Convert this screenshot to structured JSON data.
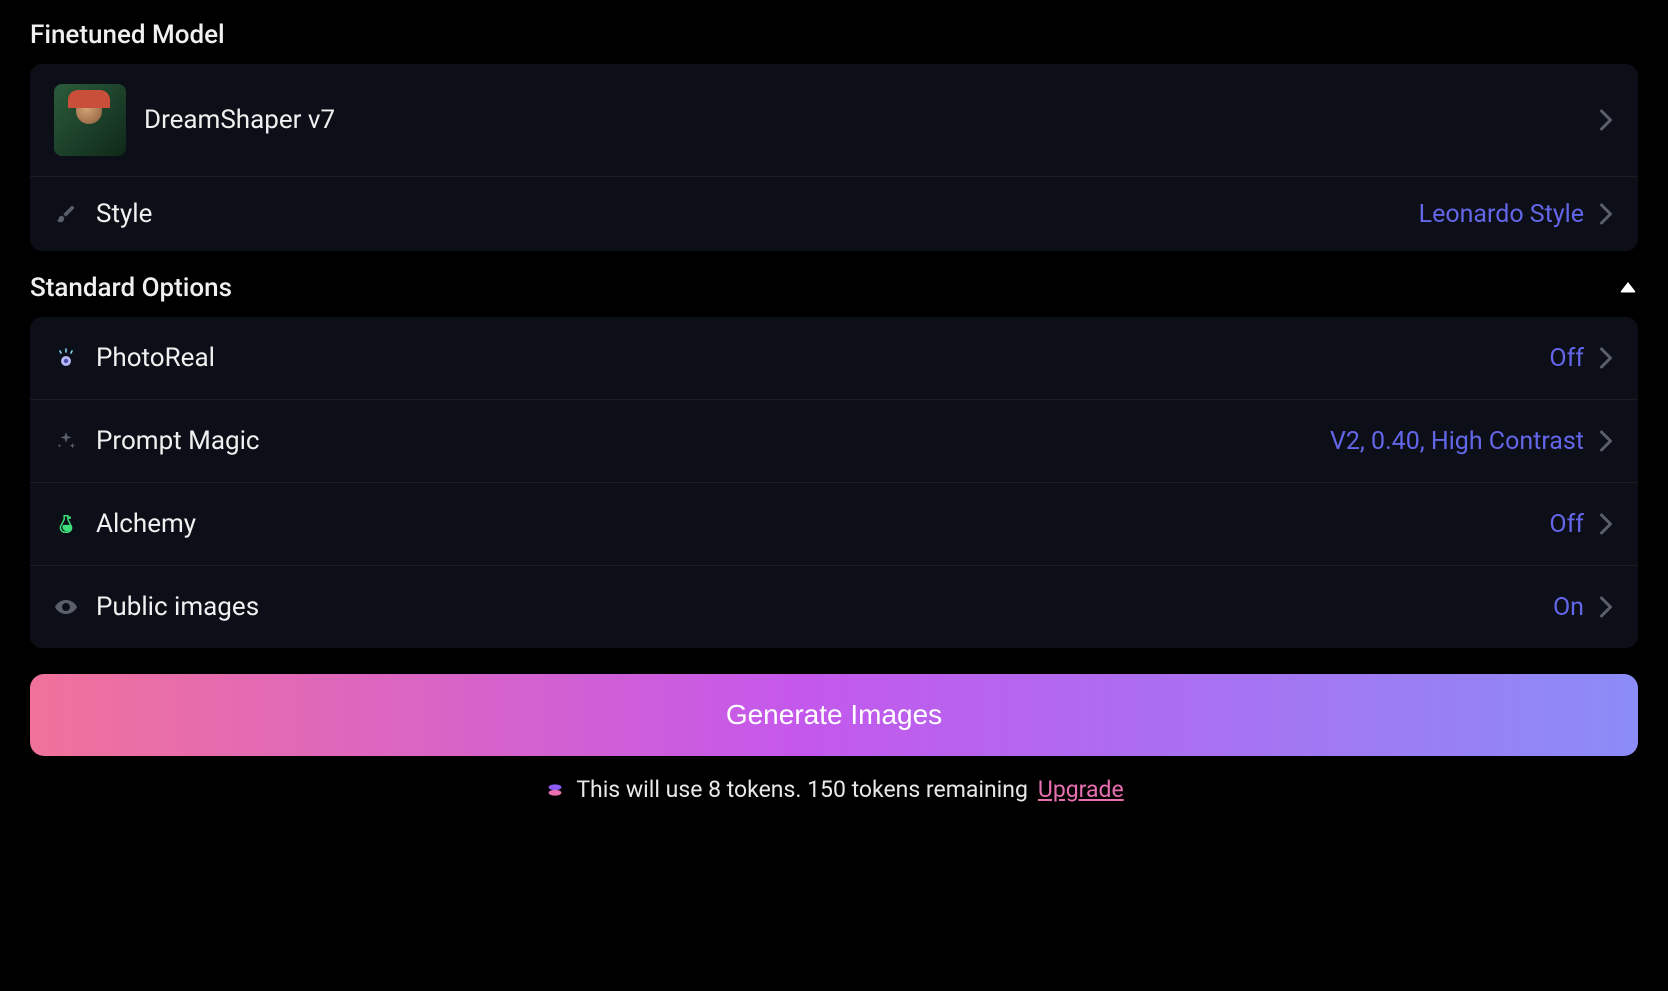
{
  "sections": {
    "finetuned_title": "Finetuned Model",
    "standard_title": "Standard Options"
  },
  "model": {
    "name": "DreamShaper v7",
    "style_label": "Style",
    "style_value": "Leonardo Style"
  },
  "options": {
    "photoreal": {
      "label": "PhotoReal",
      "value": "Off"
    },
    "prompt_magic": {
      "label": "Prompt Magic",
      "value": "V2, 0.40, High Contrast"
    },
    "alchemy": {
      "label": "Alchemy",
      "value": "Off"
    },
    "public_images": {
      "label": "Public images",
      "value": "On"
    }
  },
  "generate": {
    "button": "Generate Images",
    "note_prefix": "This will use ",
    "tokens_cost": "8",
    "note_mid": " tokens. ",
    "tokens_remaining": "150",
    "note_suffix": " tokens remaining",
    "upgrade": "Upgrade"
  }
}
